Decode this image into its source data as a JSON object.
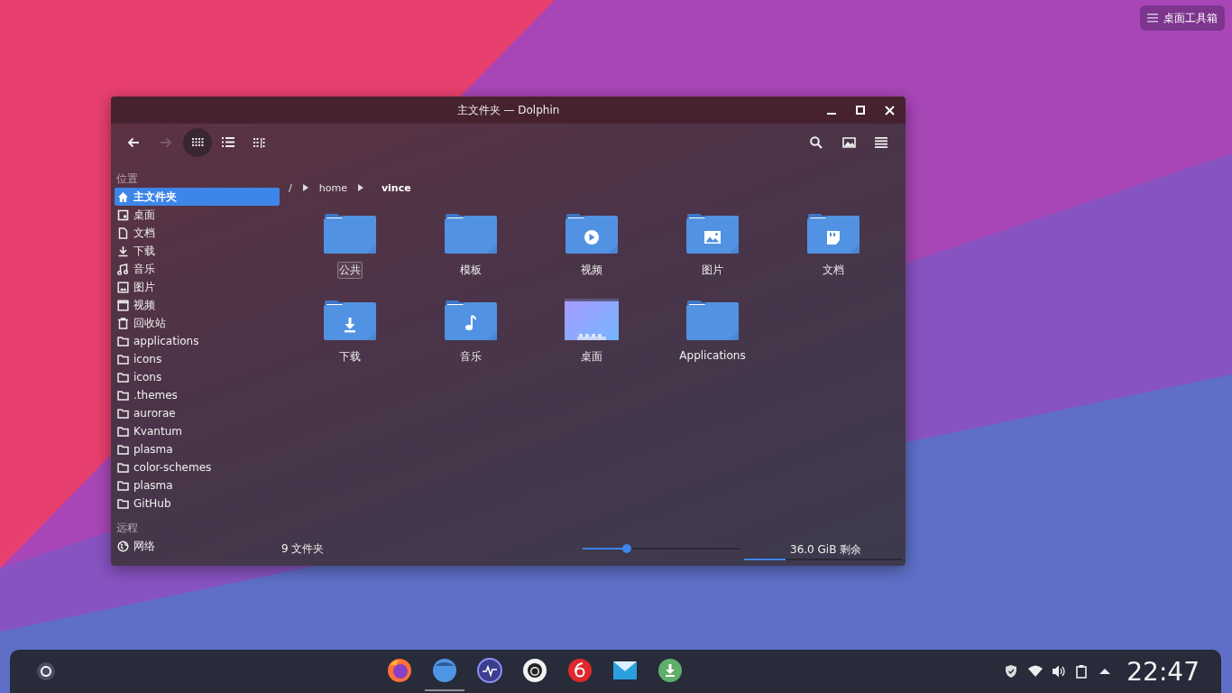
{
  "desktop_toolbox": {
    "label": "桌面工具箱"
  },
  "window": {
    "title": "主文件夹 — Dolphin",
    "toolbar": {
      "navigation": [
        {
          "kind": "back",
          "disabled": false
        },
        {
          "kind": "forward",
          "disabled": true
        }
      ],
      "view_modes": [
        {
          "kind": "icons",
          "selected": true
        },
        {
          "kind": "details",
          "selected": false
        },
        {
          "kind": "compact",
          "selected": false
        }
      ],
      "actions": [
        {
          "kind": "search"
        },
        {
          "kind": "preview"
        },
        {
          "kind": "menu"
        }
      ]
    },
    "sidebar": [
      {
        "heading": "位置",
        "items": [
          {
            "label": "主文件夹",
            "kind": "home",
            "selected": true
          },
          {
            "label": "桌面",
            "kind": "desktop",
            "selected": false
          },
          {
            "label": "文档",
            "kind": "document",
            "selected": false
          },
          {
            "label": "下载",
            "kind": "download",
            "selected": false
          },
          {
            "label": "音乐",
            "kind": "music",
            "selected": false
          },
          {
            "label": "图片",
            "kind": "image",
            "selected": false
          },
          {
            "label": "视频",
            "kind": "video",
            "selected": false
          },
          {
            "label": "回收站",
            "kind": "trash",
            "selected": false
          },
          {
            "label": "applications",
            "kind": "folder",
            "selected": false
          },
          {
            "label": "icons",
            "kind": "folder",
            "selected": false
          },
          {
            "label": "icons",
            "kind": "folder",
            "selected": false
          },
          {
            "label": ".themes",
            "kind": "folder",
            "selected": false
          },
          {
            "label": "aurorae",
            "kind": "folder",
            "selected": false
          },
          {
            "label": "Kvantum",
            "kind": "folder",
            "selected": false
          },
          {
            "label": "plasma",
            "kind": "folder",
            "selected": false
          },
          {
            "label": "color-schemes",
            "kind": "folder",
            "selected": false
          },
          {
            "label": "plasma",
            "kind": "folder",
            "selected": false
          },
          {
            "label": "GitHub",
            "kind": "folder",
            "selected": false
          }
        ]
      },
      {
        "heading": "远程",
        "items": [
          {
            "label": "网络",
            "kind": "network",
            "selected": false
          }
        ]
      }
    ],
    "breadcrumb": [
      {
        "label": "/",
        "selected": false
      },
      {
        "label": "home",
        "selected": false
      },
      {
        "label": "vince",
        "selected": true
      }
    ],
    "files": [
      {
        "name": "公共",
        "kind": "plain",
        "focused": true
      },
      {
        "name": "模板",
        "kind": "plain",
        "focused": false
      },
      {
        "name": "视频",
        "kind": "video",
        "focused": false
      },
      {
        "name": "图片",
        "kind": "image",
        "focused": false
      },
      {
        "name": "文档",
        "kind": "document",
        "focused": false
      },
      {
        "name": "下载",
        "kind": "download",
        "focused": false
      },
      {
        "name": "音乐",
        "kind": "music",
        "focused": false
      },
      {
        "name": "桌面",
        "kind": "desktop",
        "focused": false
      },
      {
        "name": "Applications",
        "kind": "plain",
        "focused": false
      }
    ],
    "status_bar": {
      "summary": "9 文件夹",
      "zoom": {
        "level": 0.28
      },
      "free_space": "36.0 GiB 剩余",
      "disk_usage": {
        "level": 0.26
      }
    }
  },
  "taskbar": {
    "apps": [
      {
        "kind": "firefox",
        "active": false
      },
      {
        "kind": "files",
        "active": true
      },
      {
        "kind": "monitor",
        "active": false
      },
      {
        "kind": "github",
        "active": false
      },
      {
        "kind": "music",
        "active": false
      },
      {
        "kind": "mail",
        "active": false
      },
      {
        "kind": "download",
        "active": false
      }
    ],
    "tray": [
      {
        "kind": "shield"
      },
      {
        "kind": "wifi"
      },
      {
        "kind": "volume"
      },
      {
        "kind": "clipboard"
      },
      {
        "kind": "expand"
      }
    ],
    "clock": "22:47"
  }
}
